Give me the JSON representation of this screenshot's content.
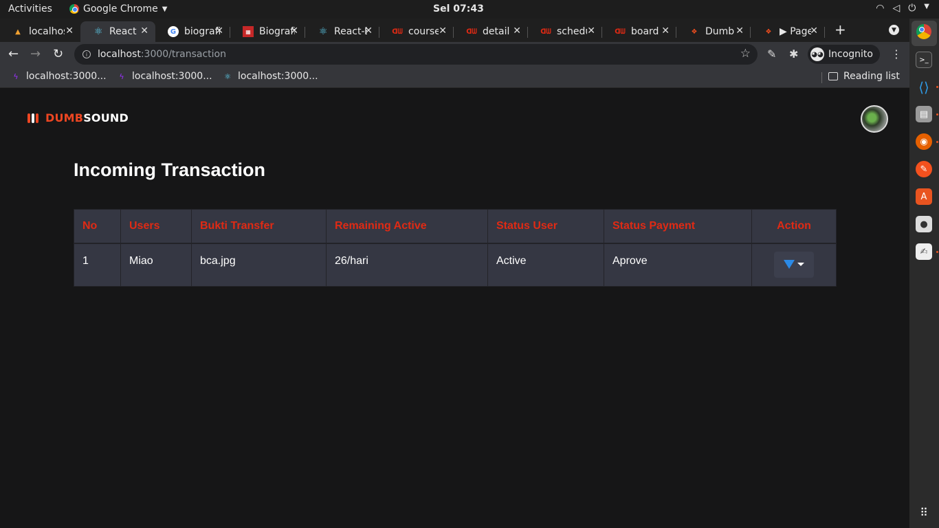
{
  "system_bar": {
    "activities": "Activities",
    "app_name": "Google Chrome",
    "clock": "Sel 07:43"
  },
  "tabs": [
    {
      "title": "localhost",
      "favicon": "vite-icon"
    },
    {
      "title": "React App",
      "favicon": "react-icon"
    },
    {
      "title": "biografi",
      "favicon": "google-icon"
    },
    {
      "title": "Biografi",
      "favicon": "site-icon"
    },
    {
      "title": "React-Bootstrap",
      "favicon": "react-icon"
    },
    {
      "title": "course",
      "favicon": "dumbways-icon"
    },
    {
      "title": "detail",
      "favicon": "dumbways-icon"
    },
    {
      "title": "schedule",
      "favicon": "dumbways-icon"
    },
    {
      "title": "board",
      "favicon": "dumbways-icon"
    },
    {
      "title": "Dumb",
      "favicon": "figma-icon"
    },
    {
      "title": "▶ Page",
      "favicon": "figma-icon"
    }
  ],
  "address_bar": {
    "host": "localhost",
    "path": ":3000/transaction"
  },
  "profile": {
    "label": "Incognito"
  },
  "bookmarks": [
    {
      "label": "localhost:3000...",
      "favicon": "vite-icon"
    },
    {
      "label": "localhost:3000...",
      "favicon": "vite-icon"
    },
    {
      "label": "localhost:3000...",
      "favicon": "react-icon"
    }
  ],
  "reading_list": "Reading list",
  "app": {
    "brand_part1": "DUMB",
    "brand_part2": "SOUND",
    "title": "Incoming Transaction",
    "brand_color": "#ee4622",
    "header_color": "#e02a14"
  },
  "table": {
    "columns": [
      "No",
      "Users",
      "Bukti Transfer",
      "Remaining Active",
      "Status User",
      "Status Payment",
      "Action"
    ],
    "rows": [
      {
        "no": "1",
        "user": "Miao",
        "proof": "bca.jpg",
        "remaining": "26/hari",
        "status_user": "Active",
        "status_payment": "Aprove"
      }
    ]
  }
}
